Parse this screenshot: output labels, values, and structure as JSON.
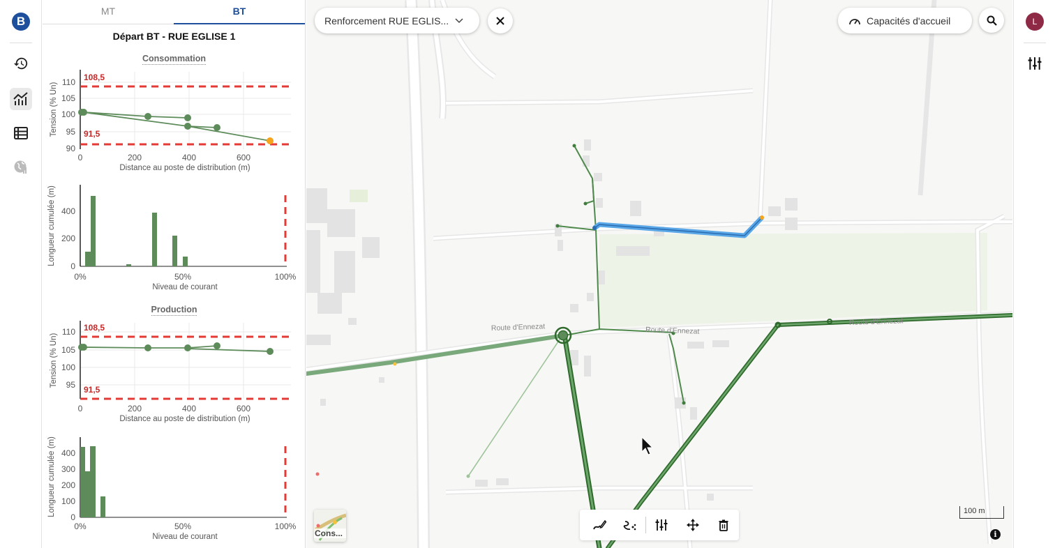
{
  "logo_letter": "B",
  "avatar_letter": "L",
  "tabs": [
    {
      "label": "MT",
      "active": false
    },
    {
      "label": "BT",
      "active": true
    }
  ],
  "panel_title": "Départ BT - RUE EGLISE 1",
  "consumption": {
    "section_title": "Consommation",
    "voltage_chart": {
      "ylabel": "Tension (% Un)",
      "xlabel": "Distance au poste de distribution (m)",
      "yticks": [
        "110",
        "105",
        "100",
        "95",
        "90"
      ],
      "xticks": [
        "0",
        "200",
        "400",
        "600"
      ],
      "upper_limit": "108,5",
      "lower_limit": "91,5"
    },
    "current_chart": {
      "ylabel": "Longueur cumulée (m)",
      "xlabel": "Niveau de courant",
      "yticks": [
        "400",
        "200",
        "0"
      ],
      "xticks": [
        "0%",
        "50%",
        "100%"
      ]
    }
  },
  "production": {
    "section_title": "Production",
    "voltage_chart": {
      "ylabel": "Tension (% Un)",
      "xlabel": "Distance au poste de distribution (m)",
      "yticks": [
        "110",
        "105",
        "100",
        "95"
      ],
      "xticks": [
        "0",
        "200",
        "400",
        "600"
      ],
      "upper_limit": "108,5",
      "lower_limit": "91,5"
    },
    "current_chart": {
      "ylabel": "Longueur cumulée (m)",
      "xlabel": "Niveau de courant",
      "yticks": [
        "400",
        "300",
        "200",
        "100",
        "0"
      ],
      "xticks": [
        "0%",
        "50%",
        "100%"
      ]
    }
  },
  "chart_data": [
    {
      "type": "scatter",
      "title": "Consommation",
      "xlabel": "Distance au poste de distribution (m)",
      "ylabel": "Tension (% Un)",
      "xlim": [
        0,
        780
      ],
      "ylim": [
        90,
        112
      ],
      "thresholds": [
        108.5,
        91.5
      ],
      "series": [
        {
          "x": [
            0,
            15,
            250,
            395,
            490,
            700
          ],
          "y": [
            101,
            101,
            99.5,
            99,
            96.2,
            92.5
          ]
        },
        {
          "x": [
            395
          ],
          "y": [
            96.8
          ]
        }
      ],
      "grid": true
    },
    {
      "type": "bar",
      "title": "Consommation",
      "xlabel": "Niveau de courant",
      "ylabel": "Longueur cumulée (m)",
      "xlim": [
        0,
        100
      ],
      "ylim": [
        0,
        520
      ],
      "x": [
        3,
        5,
        7,
        24,
        36,
        46,
        51
      ],
      "values": [
        110,
        135,
        510,
        15,
        385,
        225,
        70
      ],
      "threshold": 100
    },
    {
      "type": "scatter",
      "title": "Production",
      "xlabel": "Distance au poste de distribution (m)",
      "ylabel": "Tension (% Un)",
      "xlim": [
        0,
        780
      ],
      "ylim": [
        92,
        112
      ],
      "thresholds": [
        108.5,
        91.5
      ],
      "series": [
        {
          "x": [
            0,
            15,
            250,
            395,
            490,
            700
          ],
          "y": [
            105.7,
            105.7,
            105.5,
            105.5,
            106.1,
            104.8
          ]
        }
      ],
      "grid": true
    },
    {
      "type": "bar",
      "title": "Production",
      "xlabel": "Niveau de courant",
      "ylabel": "Longueur cumulée (m)",
      "xlim": [
        0,
        100
      ],
      "ylim": [
        0,
        480
      ],
      "x": [
        1,
        4,
        6,
        11
      ],
      "values": [
        445,
        290,
        450,
        130
      ],
      "threshold": 100
    }
  ],
  "map": {
    "project_select": "Renforcement RUE EGLIS...",
    "capacity_button": "Capacités d'accueil",
    "road_labels": [
      "Route d'Ennezat",
      "Route d'Ennezat",
      "Route d'Ennezat"
    ],
    "scale_label": "100 m",
    "layer_label": "Cons..."
  }
}
